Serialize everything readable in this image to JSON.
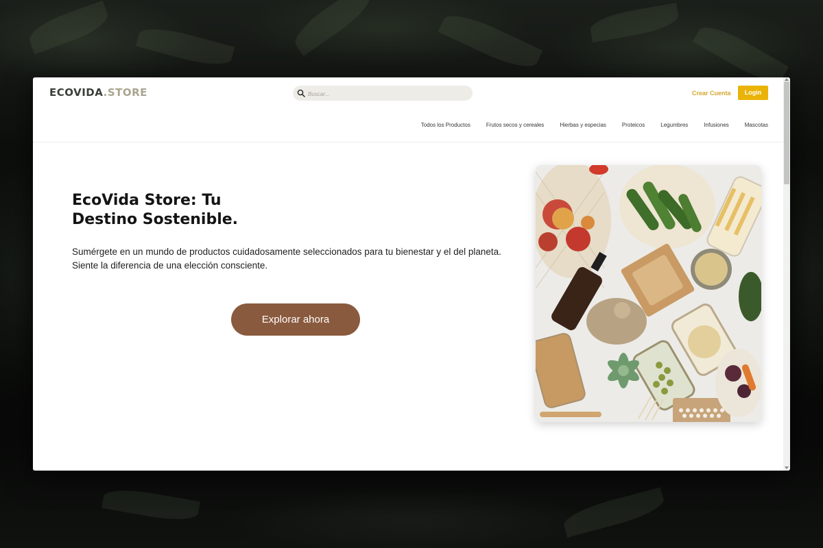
{
  "header": {
    "logo_main": "ECOVIDA",
    "logo_accent": ".STORE",
    "search_placeholder": "Buscar...",
    "search_icon": "search-icon",
    "create_account_label": "Crear Cuenta",
    "login_label": "Login"
  },
  "nav": {
    "items": [
      "Todos los Productos",
      "Frutos secos y cereales",
      "Hierbas y especias",
      "Proteicos",
      "Legumbres",
      "Infusiones",
      "Mascotas"
    ]
  },
  "hero": {
    "title_line1": "EcoVida Store: Tu",
    "title_line2": "Destino Sostenible.",
    "description": "Sumérgete en un mundo de productos cuidadosamente seleccionados para tu bienestar y el del planeta. Siente la diferencia de una elección consciente.",
    "cta_label": "Explorar ahora"
  },
  "colors": {
    "accent_yellow": "#eab308",
    "cta_brown": "#8a5a3e",
    "logo_accent": "#a8a58f"
  }
}
